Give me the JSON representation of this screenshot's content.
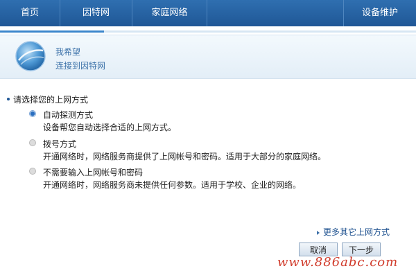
{
  "nav": {
    "items": [
      "首页",
      "因特网",
      "家庭网络"
    ],
    "last": "设备维护"
  },
  "progress": {
    "fraction": 0.25
  },
  "header": {
    "title": "我希望",
    "subtitle": "连接到因特网",
    "icon": "globe-icon"
  },
  "question": "请选择您的上网方式",
  "options": [
    {
      "title": "自动探测方式",
      "desc": "设备帮您自动选择合适的上网方式。",
      "selected": true
    },
    {
      "title": "拨号方式",
      "desc": "开通网络时，网络服务商提供了上网帐号和密码。适用于大部分的家庭网络。",
      "selected": false
    },
    {
      "title": "不需要输入上网帐号和密码",
      "desc": "开通网络时，网络服务商未提供任何参数。适用于学校、企业的网络。",
      "selected": false
    }
  ],
  "more_link": "更多其它上网方式",
  "buttons": {
    "cancel": "取消",
    "next": "下一步"
  },
  "watermark": "www.886abc.com",
  "colors": {
    "nav": "#1f5796",
    "accent": "#3a70a8",
    "watermark": "#d03a2a"
  }
}
